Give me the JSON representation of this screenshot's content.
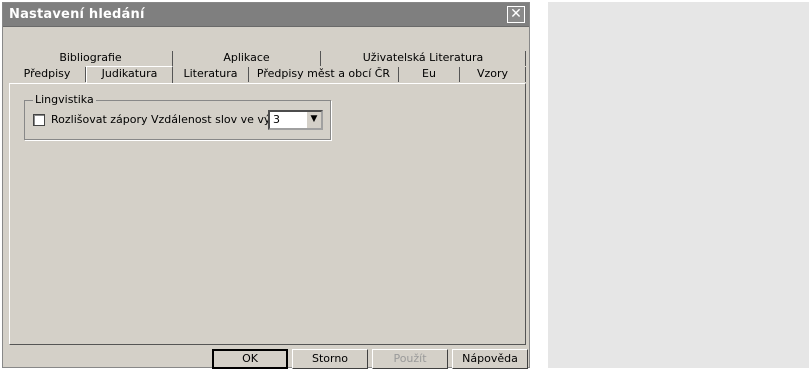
{
  "dialog": {
    "title": "Nastavení hledání",
    "close_glyph": "✕"
  },
  "tabs_row1": [
    {
      "label": "Bibliografie"
    },
    {
      "label": "Aplikace"
    },
    {
      "label": "Uživatelská Literatura"
    }
  ],
  "tabs_row2": [
    {
      "label": "Předpisy"
    },
    {
      "label": "Judikatura"
    },
    {
      "label": "Literatura"
    },
    {
      "label": "Předpisy měst a obcí ČR"
    },
    {
      "label": "Eu"
    },
    {
      "label": "Vzory"
    }
  ],
  "active_tab": "Judikatura",
  "group": {
    "label": "Lingvistika",
    "checkbox_label": "Rozlišovat zápory",
    "checkbox_checked": false,
    "distance_label": "Vzdálenost slov ve výrazu:",
    "distance_value": "3"
  },
  "buttons": {
    "ok": "OK",
    "cancel": "Storno",
    "apply": "Použít",
    "help": "Nápověda"
  },
  "icons": {
    "close": "close-icon",
    "dropdown": "chevron-down-icon"
  }
}
